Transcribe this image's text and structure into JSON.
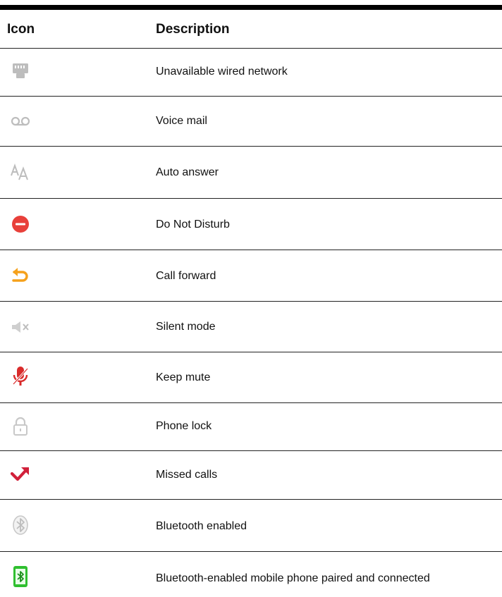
{
  "table": {
    "headers": {
      "icon": "Icon",
      "description": "Description"
    },
    "rows": [
      {
        "icon": "wired-network-unavailable-icon",
        "description": "Unavailable wired network"
      },
      {
        "icon": "voicemail-icon",
        "description": "Voice mail"
      },
      {
        "icon": "auto-answer-icon",
        "description": "Auto answer"
      },
      {
        "icon": "do-not-disturb-icon",
        "description": "Do Not Disturb"
      },
      {
        "icon": "call-forward-icon",
        "description": "Call forward"
      },
      {
        "icon": "silent-mode-icon",
        "description": "Silent mode"
      },
      {
        "icon": "keep-mute-icon",
        "description": "Keep mute"
      },
      {
        "icon": "phone-lock-icon",
        "description": "Phone lock"
      },
      {
        "icon": "missed-calls-icon",
        "description": "Missed calls"
      },
      {
        "icon": "bluetooth-enabled-icon",
        "description": "Bluetooth enabled"
      },
      {
        "icon": "bluetooth-phone-connected-icon",
        "description": "Bluetooth-enabled mobile phone paired and connected"
      }
    ]
  },
  "colors": {
    "dnd_red": "#e8403a",
    "forward_orange": "#f5a11b",
    "mute_red": "#d92b2b",
    "missed_red": "#d1203a",
    "bt_green": "#2fbf2f",
    "icon_gray": "#bdbdbd"
  }
}
